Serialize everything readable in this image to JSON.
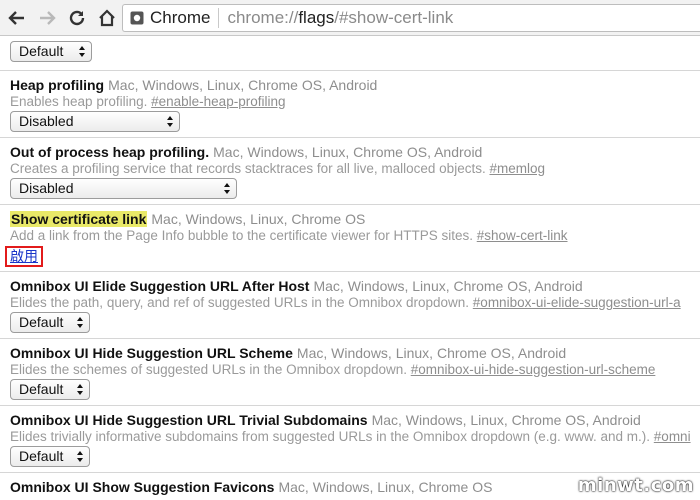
{
  "toolbar": {
    "back_icon": "arrow-left-icon",
    "forward_icon": "arrow-right-icon",
    "reload_icon": "reload-icon",
    "home_icon": "home-icon",
    "chip_label": "Chrome",
    "url_scheme": "chrome://",
    "url_host": "flags",
    "url_rest": "/#show-cert-link"
  },
  "flags": [
    {
      "name": "",
      "platforms": "",
      "desc": "",
      "link": "",
      "control": "select",
      "value": "Default"
    },
    {
      "name": "Heap profiling",
      "platforms": "Mac, Windows, Linux, Chrome OS, Android",
      "desc": "Enables heap profiling.",
      "link": "#enable-heap-profiling",
      "control": "select",
      "value": "Disabled"
    },
    {
      "name": "Out of process heap profiling.",
      "platforms": "Mac, Windows, Linux, Chrome OS, Android",
      "desc": "Creates a profiling service that records stacktraces for all live, malloced objects.",
      "link": "#memlog",
      "control": "select",
      "value": "Disabled"
    },
    {
      "name": "Show certificate link",
      "platforms": "Mac, Windows, Linux, Chrome OS",
      "desc": "Add a link from the Page Info bubble to the certificate viewer for HTTPS sites.",
      "link": "#show-cert-link",
      "control": "link",
      "value": "啟用"
    },
    {
      "name": "Omnibox UI Elide Suggestion URL After Host",
      "platforms": "Mac, Windows, Linux, Chrome OS, Android",
      "desc": "Elides the path, query, and ref of suggested URLs in the Omnibox dropdown.",
      "link": "#omnibox-ui-elide-suggestion-url-a",
      "control": "select",
      "value": "Default"
    },
    {
      "name": "Omnibox UI Hide Suggestion URL Scheme",
      "platforms": "Mac, Windows, Linux, Chrome OS, Android",
      "desc": "Elides the schemes of suggested URLs in the Omnibox dropdown.",
      "link": "#omnibox-ui-hide-suggestion-url-scheme",
      "control": "select",
      "value": "Default"
    },
    {
      "name": "Omnibox UI Hide Suggestion URL Trivial Subdomains",
      "platforms": "Mac, Windows, Linux, Chrome OS, Android",
      "desc": "Elides trivially informative subdomains from suggested URLs in the Omnibox dropdown (e.g. www. and m.).",
      "link": "#omni",
      "control": "select",
      "value": "Default"
    },
    {
      "name": "Omnibox UI Show Suggestion Favicons",
      "platforms": "Mac, Windows, Linux, Chrome OS",
      "desc": "",
      "link": "",
      "control": "none",
      "value": ""
    }
  ],
  "watermark": "minwt.com",
  "colors": {
    "highlight": "#e9e968",
    "enable_border": "#e21b1b",
    "enable_link": "#1a35c9"
  }
}
